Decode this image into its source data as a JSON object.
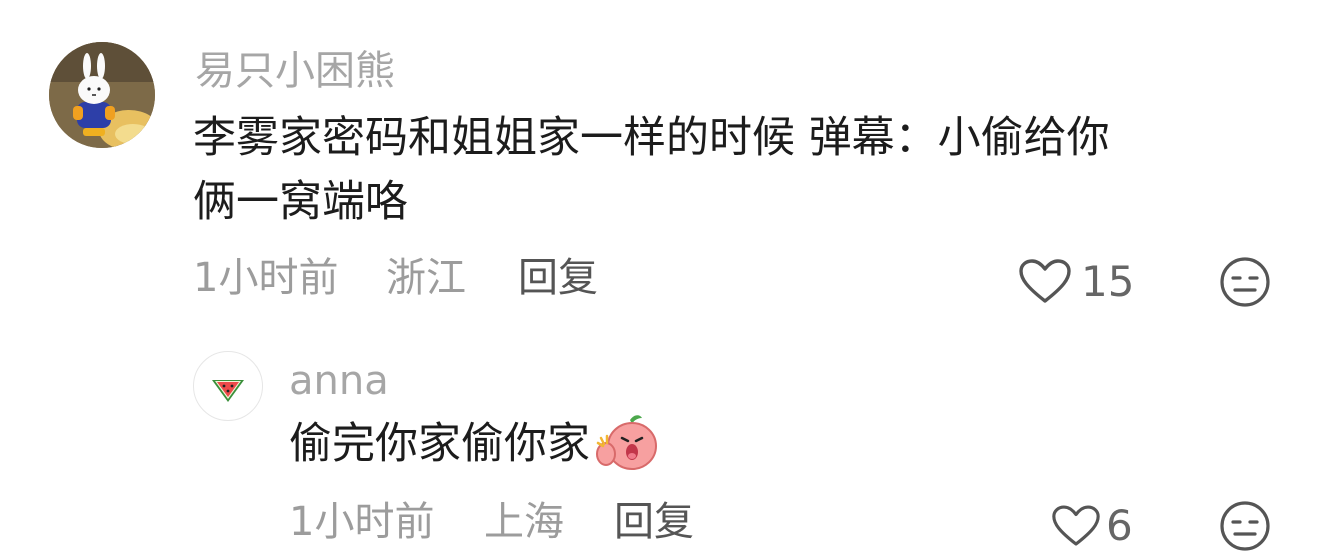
{
  "comment": {
    "username": "易只小困熊",
    "content_line1": "李雾家密码和姐姐家一样的时候 弹幕：小偷给你",
    "content_line2": "俩一窝端咯",
    "time": "1小时前",
    "location": "浙江",
    "reply_label": "回复",
    "like_count": "15",
    "avatar_icon": "bunny-figure-avatar",
    "like_icon": "heart-outline-icon",
    "dislike_icon": "meh-face-icon"
  },
  "reply": {
    "username": "anna",
    "content": "偷完你家偷你家",
    "emoji_icon": "peach-pointing-emoji",
    "time": "1小时前",
    "location": "上海",
    "reply_label": "回复",
    "like_count": "6",
    "avatar_icon": "watermelon-avatar",
    "like_icon": "heart-outline-icon",
    "dislike_icon": "meh-face-icon"
  }
}
